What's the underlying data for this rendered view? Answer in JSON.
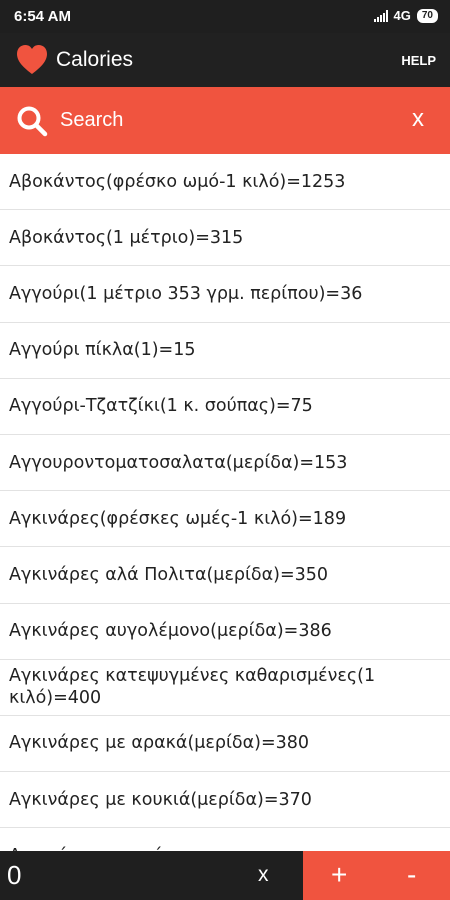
{
  "status_bar": {
    "time": "6:54 AM",
    "network": "4G",
    "battery": "70"
  },
  "app_bar": {
    "title": "Calories",
    "help_label": "HELP"
  },
  "search": {
    "placeholder": "Search",
    "clear_label": "x"
  },
  "items": [
    "Αβοκάντος(φρέσκο ωμό-1 κιλό)=1253",
    "Αβοκάντος(1 μέτριο)=315",
    "Αγγούρι(1 μέτριο 353 γρμ. περίπου)=36",
    "Αγγούρι πίκλα(1)=15",
    "Αγγούρι-Τζατζίκι(1 κ. σούπας)=75",
    "Αγγουροντοματοσαλατα(μερίδα)=153",
    "Αγκινάρες(φρέσκες ωμές-1 κιλό)=189",
    "Αγκινάρες αλά Πολιτα(μερίδα)=350",
    "Αγκινάρες αυγολέμονο(μερίδα)=386",
    "Αγκινάρες κατεψυγμένες καθαρισμένες(1 κιλό)=400",
    "Αγκινάρες με αρακά(μερίδα)=380",
    "Αγκινάρες με κουκιά(μερίδα)=370",
    "Αγκινάρες με κρέας"
  ],
  "bottom_bar": {
    "quantity": "0",
    "clear_label": "x",
    "plus_label": "+",
    "minus_label": "-"
  },
  "colors": {
    "accent": "#f0543f",
    "dark": "#212121"
  },
  "icons": {
    "logo": "heart-icon",
    "search": "search-icon"
  }
}
